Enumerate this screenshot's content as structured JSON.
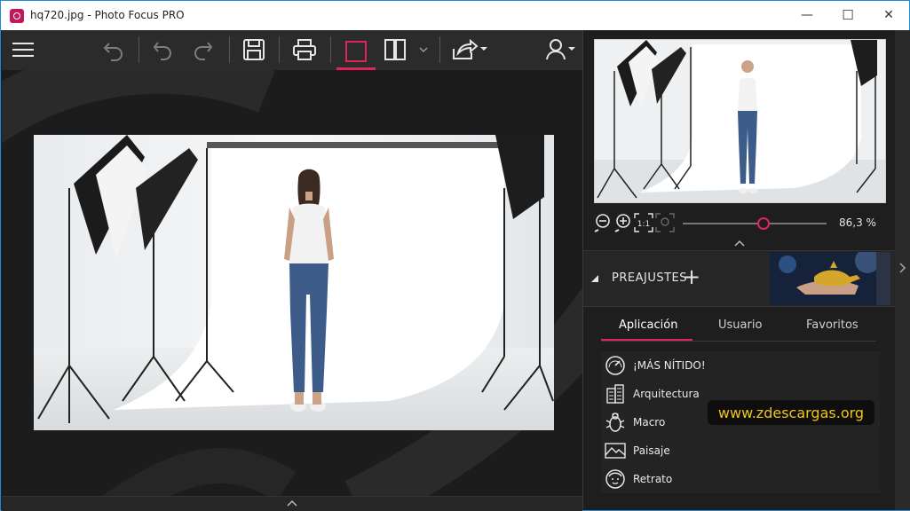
{
  "window": {
    "title": "hq720.jpg - Photo Focus PRO",
    "controls": {
      "minimize": "—",
      "maximize": "☐",
      "close": "✕"
    }
  },
  "toolbar": {
    "icons": [
      "menu-icon",
      "undo-icon",
      "undo-step-icon",
      "redo-icon",
      "save-icon",
      "print-icon",
      "single-view-icon",
      "split-view-icon",
      "chevron-down-icon",
      "share-icon",
      "user-icon"
    ]
  },
  "navigator": {
    "zoom_label": "86,3 %",
    "zoom_value_fraction": 0.56,
    "zoom_icons": [
      "zoom-out-icon",
      "zoom-in-icon",
      "actual-size-icon",
      "fit-icon"
    ]
  },
  "presets": {
    "header_label": "PREAJUSTES",
    "add_label": "+",
    "tabs": [
      {
        "label": "Aplicación",
        "active": true
      },
      {
        "label": "Usuario",
        "active": false
      },
      {
        "label": "Favoritos",
        "active": false
      }
    ],
    "items": [
      {
        "label": "¡MÁS NÍTIDO!",
        "icon": "gauge-icon"
      },
      {
        "label": "Arquitectura",
        "icon": "building-icon"
      },
      {
        "label": "Macro",
        "icon": "bug-icon"
      },
      {
        "label": "Paisaje",
        "icon": "landscape-icon"
      },
      {
        "label": "Retrato",
        "icon": "face-icon"
      }
    ]
  },
  "watermark": "www.zdescargas.org",
  "colors": {
    "accent": "#e0245e",
    "toolbar_bg": "#2b2b2b",
    "panel_bg": "#1e1e1e",
    "title_bar_bg": "#ffffff",
    "watermark_text": "#f0c419"
  }
}
